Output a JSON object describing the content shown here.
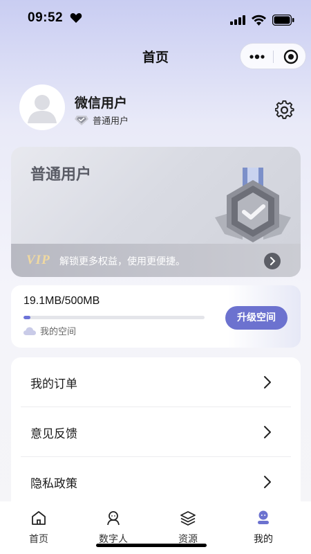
{
  "status_bar": {
    "time": "09:52"
  },
  "nav": {
    "title": "首页"
  },
  "profile": {
    "name": "微信用户",
    "level": "普通用户"
  },
  "member_card": {
    "title": "普通用户",
    "vip_tag": "VIP",
    "vip_text": "解锁更多权益，使用更便捷。"
  },
  "storage": {
    "amount": "19.1MB/500MB",
    "used_fraction": 0.038,
    "label": "我的空间",
    "upgrade_label": "升级空间"
  },
  "menu": {
    "items": [
      {
        "label": "我的订单"
      },
      {
        "label": "意见反馈"
      },
      {
        "label": "隐私政策"
      }
    ]
  },
  "tabs": [
    {
      "label": "首页",
      "icon": "home-icon"
    },
    {
      "label": "数字人",
      "icon": "digital-human-icon"
    },
    {
      "label": "资源",
      "icon": "layers-icon"
    },
    {
      "label": "我的",
      "icon": "profile-icon",
      "active": true
    }
  ],
  "colors": {
    "accent": "#6c72cf",
    "active_tab": "#6c72cf"
  }
}
